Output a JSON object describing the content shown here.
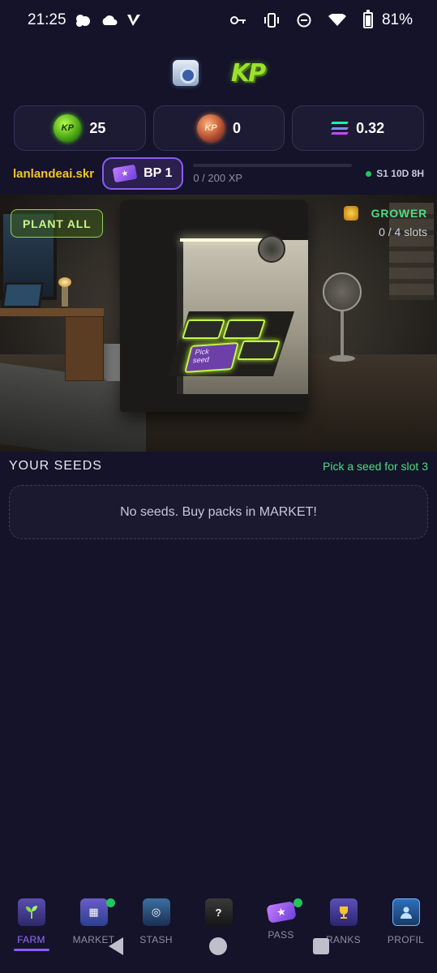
{
  "status_bar": {
    "time": "21:25",
    "battery": "81%",
    "icons": [
      "weather-icon",
      "cloud-icon",
      "v-app-icon",
      "key-icon",
      "vibrate-icon",
      "dnd-icon",
      "wifi-icon",
      "battery-icon"
    ]
  },
  "header": {
    "logo_text": "KP",
    "icons": [
      "speaker-icon",
      "kp-logo"
    ]
  },
  "currencies": [
    {
      "icon": "kp-coin-icon",
      "value": "25",
      "icon_label": "KP"
    },
    {
      "icon": "kp-token-icon",
      "value": "0",
      "icon_label": "KP"
    },
    {
      "icon": "solana-icon",
      "value": "0.32"
    }
  ],
  "profile": {
    "username": "lanlandeai.skr",
    "bp_label": "BP 1",
    "xp_text": "0 / 200 XP",
    "xp_progress": 0,
    "season_text": "S1 10D 8H"
  },
  "scene": {
    "plant_all_label": "PLANT ALL",
    "grower_label": "GROWER",
    "slots_text": "0 / 4 slots",
    "pick_seed_label": "Pick\nseed"
  },
  "seeds": {
    "title": "YOUR SEEDS",
    "hint": "Pick a seed for slot 3",
    "empty_text": "No seeds. Buy packs in MARKET!"
  },
  "nav": {
    "items": [
      {
        "label": "FARM",
        "active": true,
        "badge": false
      },
      {
        "label": "MARKET",
        "active": false,
        "badge": true
      },
      {
        "label": "STASH",
        "active": false,
        "badge": false
      },
      {
        "label": "",
        "active": false,
        "badge": false
      },
      {
        "label": "PASS",
        "active": false,
        "badge": true
      },
      {
        "label": "RANKS",
        "active": false,
        "badge": false
      },
      {
        "label": "PROFIL",
        "active": false,
        "badge": false
      }
    ]
  },
  "colors": {
    "background": "#14132a",
    "accent_purple": "#8b5cf6",
    "accent_green": "#4ade80",
    "username_gold": "#f4c430"
  }
}
